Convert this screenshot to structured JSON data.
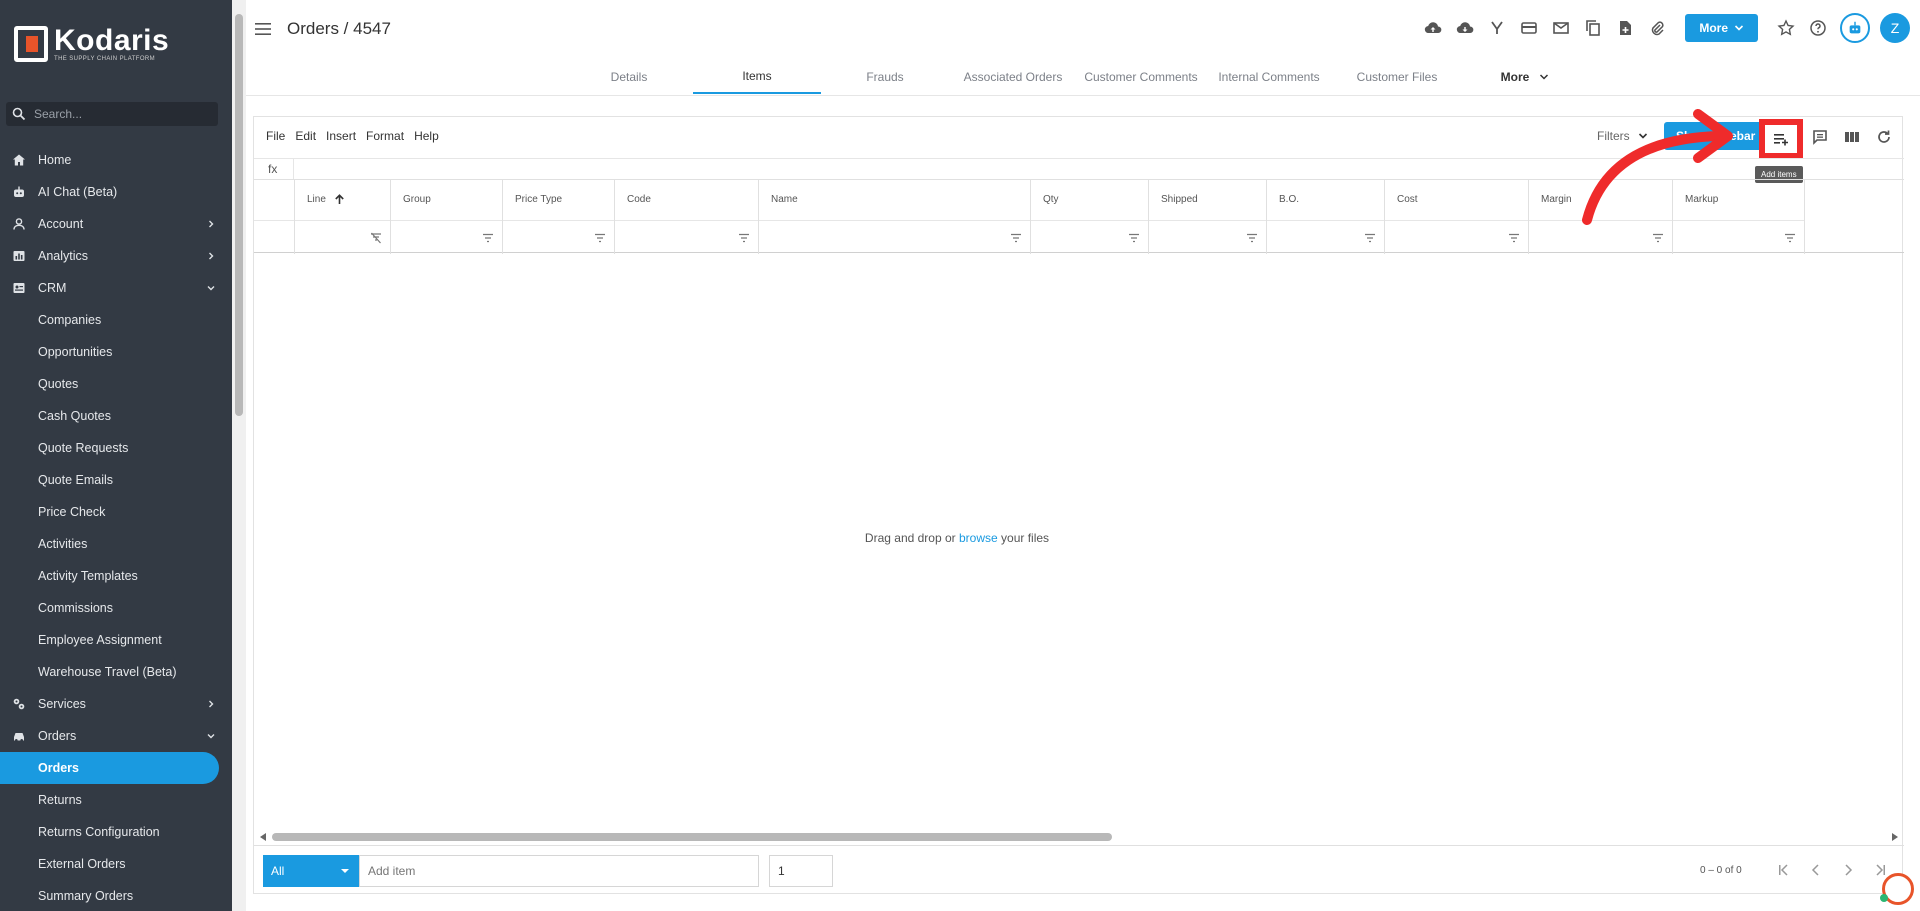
{
  "brand": {
    "name": "Kodaris",
    "tagline": "THE SUPPLY CHAIN PLATFORM",
    "accent": "#1a9ae0",
    "logo_color": "#e8542a"
  },
  "search": {
    "placeholder": "Search..."
  },
  "sidebar": {
    "items": [
      {
        "label": "Home",
        "icon": "home-icon"
      },
      {
        "label": "AI Chat (Beta)",
        "icon": "robot-icon"
      },
      {
        "label": "Account",
        "icon": "user-icon",
        "chevron": "right"
      },
      {
        "label": "Analytics",
        "icon": "chart-icon",
        "chevron": "right"
      },
      {
        "label": "CRM",
        "icon": "contact-icon",
        "chevron": "down"
      },
      {
        "label": "Companies"
      },
      {
        "label": "Opportunities"
      },
      {
        "label": "Quotes"
      },
      {
        "label": "Cash Quotes"
      },
      {
        "label": "Quote Requests"
      },
      {
        "label": "Quote Emails"
      },
      {
        "label": "Price Check"
      },
      {
        "label": "Activities"
      },
      {
        "label": "Activity Templates"
      },
      {
        "label": "Commissions"
      },
      {
        "label": "Employee Assignment"
      },
      {
        "label": "Warehouse Travel (Beta)"
      },
      {
        "label": "Services",
        "icon": "services-icon",
        "chevron": "right"
      },
      {
        "label": "Orders",
        "icon": "car-icon",
        "chevron": "down"
      },
      {
        "label": "Orders",
        "active": true
      },
      {
        "label": "Returns"
      },
      {
        "label": "Returns Configuration"
      },
      {
        "label": "External Orders"
      },
      {
        "label": "Summary Orders"
      }
    ]
  },
  "header": {
    "title": "Orders / 4547",
    "more_label": "More",
    "avatar_initial": "Z"
  },
  "tabs": [
    {
      "label": "Details"
    },
    {
      "label": "Items",
      "active": true
    },
    {
      "label": "Frauds"
    },
    {
      "label": "Associated Orders"
    },
    {
      "label": "Customer Comments"
    },
    {
      "label": "Internal Comments"
    },
    {
      "label": "Customer Files"
    },
    {
      "label": "More"
    }
  ],
  "grid": {
    "menu": [
      "File",
      "Edit",
      "Insert",
      "Format",
      "Help"
    ],
    "filters_label": "Filters",
    "sidebar_button": "Show Sidebar",
    "add_items_tooltip": "Add items",
    "fx_label": "fx",
    "columns": [
      "Line",
      "Group",
      "Price Type",
      "Code",
      "Name",
      "Qty",
      "Shipped",
      "B.O.",
      "Cost",
      "Margin",
      "Markup"
    ],
    "drop_text_before": "Drag and drop or",
    "drop_link": "browse",
    "drop_text_after": "your files"
  },
  "footer": {
    "select_value": "All",
    "add_item_placeholder": "Add item",
    "qty_value": "1",
    "pager_text": "0 – 0 of 0"
  },
  "annotation": {
    "color": "#ef2b2b"
  }
}
